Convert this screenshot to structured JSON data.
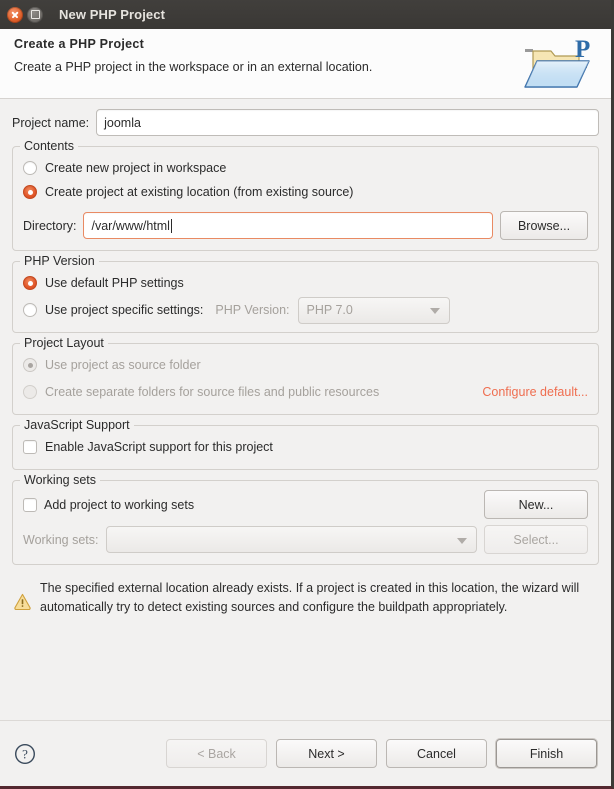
{
  "window": {
    "title": "New PHP Project",
    "close_icon": "close-icon",
    "maximize_icon": "maximize-icon"
  },
  "header": {
    "title": "Create a PHP Project",
    "description": "Create a PHP project in the workspace or in an external location.",
    "icon": "php-project-folder-icon"
  },
  "project_name": {
    "label": "Project name:",
    "value": "joomla",
    "placeholder": ""
  },
  "contents": {
    "title": "Contents",
    "option_workspace": {
      "label": "Create new project in workspace",
      "selected": false
    },
    "option_existing": {
      "label": "Create project at existing location (from existing source)",
      "selected": true
    },
    "directory": {
      "label": "Directory:",
      "value": "/var/www/html",
      "focused": true
    },
    "browse_label": "Browse..."
  },
  "php_version": {
    "title": "PHP Version",
    "option_default": {
      "label": "Use default PHP settings",
      "selected": true
    },
    "option_specific": {
      "label": "Use project specific settings:",
      "selected": false
    },
    "version_label": "PHP Version:",
    "version_value": "PHP 7.0",
    "version_options": [
      "PHP 7.0"
    ]
  },
  "project_layout": {
    "title": "Project Layout",
    "option_source_folder": {
      "label": "Use project as source folder",
      "selected": true,
      "disabled": true
    },
    "option_separate_folders": {
      "label": "Create separate folders for source files and public resources",
      "selected": false,
      "disabled": true
    },
    "configure_link": "Configure default..."
  },
  "javascript_support": {
    "title": "JavaScript Support",
    "enable_label": "Enable JavaScript support for this project",
    "enabled": false
  },
  "working_sets": {
    "title": "Working sets",
    "add_label": "Add project to working sets",
    "add_checked": false,
    "new_label": "New...",
    "sets_label": "Working sets:",
    "sets_value": "",
    "select_label": "Select..."
  },
  "warning": {
    "icon": "warning-triangle-icon",
    "text": "The specified external location already exists. If a project is created in this location, the wizard will automatically try to detect existing sources and configure the buildpath appropriately."
  },
  "footer": {
    "help_icon": "help-question-icon",
    "back_label": "< Back",
    "next_label": "Next >",
    "cancel_label": "Cancel",
    "finish_label": "Finish"
  },
  "colors": {
    "accent_orange": "#e2572a",
    "link_orange": "#ef6e50",
    "titlebar": "#3a3835",
    "dialog_bg": "#f2f1f0",
    "warning_yellow": "#f0c040"
  }
}
